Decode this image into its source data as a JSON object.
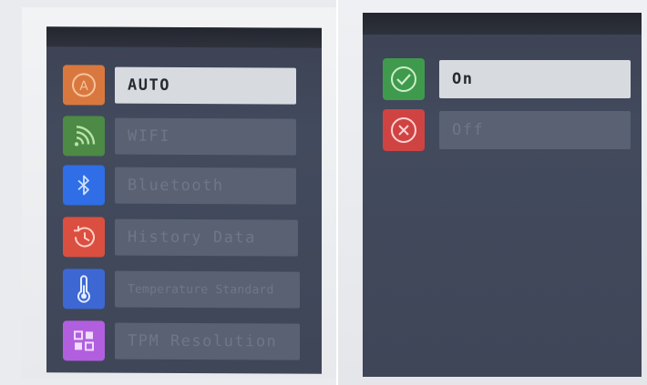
{
  "colors": {
    "auto": "#d9783e",
    "wifi": "#4c8a45",
    "bluetooth": "#2f6ee6",
    "history": "#db4f40",
    "temperature": "#3d67d3",
    "tpm": "#b15fde",
    "on": "#3f9a4d",
    "off": "#cf4343"
  },
  "menu": {
    "items": [
      {
        "label": "AUTO",
        "icon": "auto-icon",
        "selected": true
      },
      {
        "label": "WIFI",
        "icon": "wifi-icon",
        "selected": false
      },
      {
        "label": "Bluetooth",
        "icon": "bluetooth-icon",
        "selected": false
      },
      {
        "label": "History Data",
        "icon": "history-icon",
        "selected": false
      },
      {
        "label": "Temperature Standard",
        "icon": "thermometer-icon",
        "selected": false
      },
      {
        "label": "TPM Resolution",
        "icon": "grid-icon",
        "selected": false
      }
    ]
  },
  "options": {
    "items": [
      {
        "label": "On",
        "icon": "check-icon",
        "selected": true
      },
      {
        "label": "Off",
        "icon": "close-icon",
        "selected": false
      }
    ]
  }
}
